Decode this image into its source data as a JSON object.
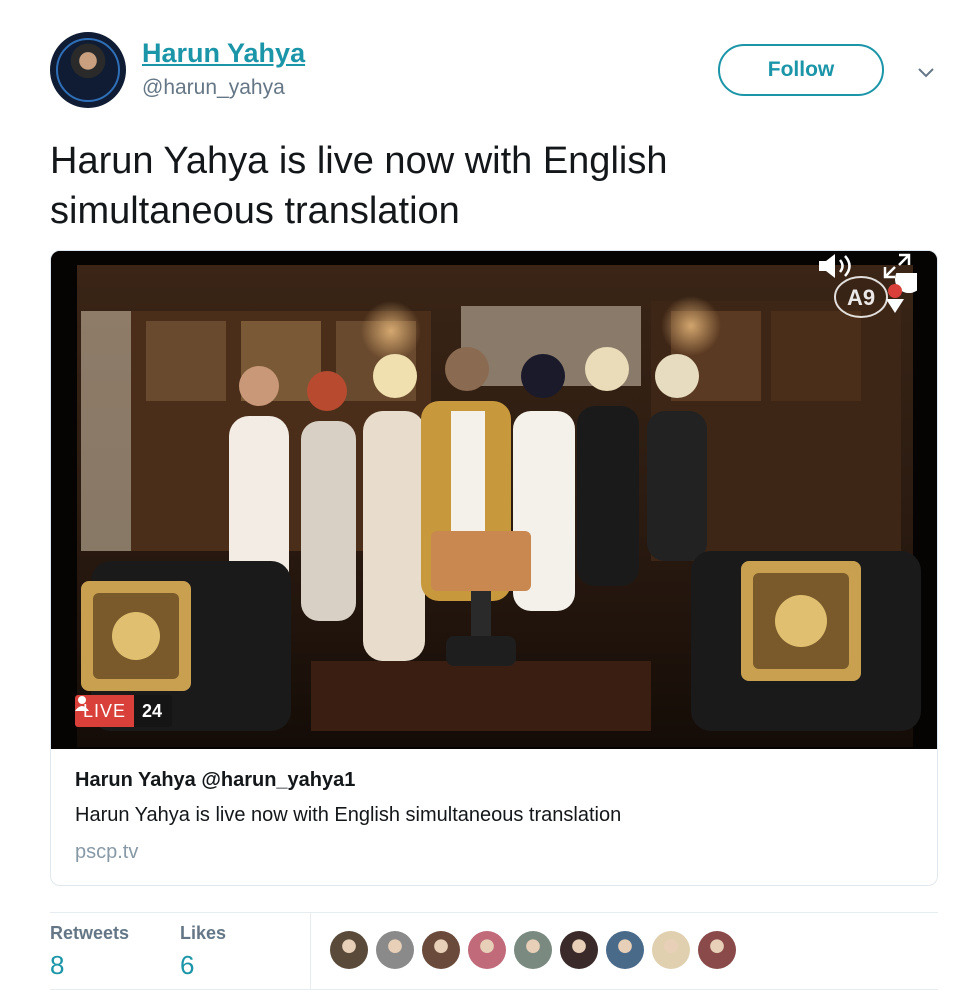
{
  "author": {
    "display_name": "Harun Yahya",
    "handle": "@harun_yahya"
  },
  "follow_label": "Follow",
  "tweet": {
    "line1": "Harun Yahya is live now with English",
    "line2": "simultaneous translation"
  },
  "card": {
    "live_label": "LIVE",
    "viewer_count": "24",
    "channel_logo": "A9",
    "title": "Harun Yahya @harun_yahya1",
    "description": "Harun Yahya is live now with English simultaneous translation",
    "domain": "pscp.tv"
  },
  "stats": {
    "retweets_label": "Retweets",
    "retweets_value": "8",
    "likes_label": "Likes",
    "likes_value": "6"
  },
  "liker_avatars": [
    "#5a4a3a",
    "#8a8a8a",
    "#6a4a3a",
    "#c06a7a",
    "#7a8a80",
    "#3a2a2a",
    "#4a6a8a",
    "#e0d0b0",
    "#8a4a4a"
  ],
  "colors": {
    "accent": "#1b95a8",
    "live_red": "#d9403a",
    "muted": "#657786"
  }
}
